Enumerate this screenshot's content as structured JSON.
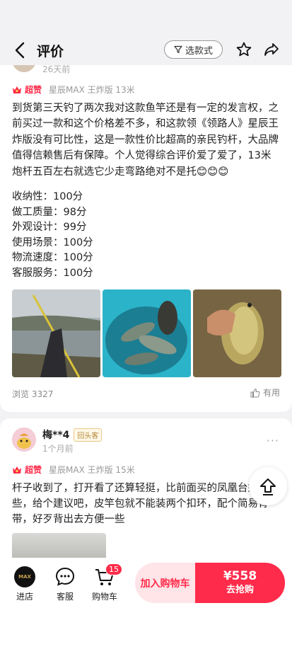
{
  "header": {
    "title": "评价",
    "filter_label": "选款式"
  },
  "review1": {
    "time": "26天前",
    "badge": "超赞",
    "spec": "星辰MAX 王炸版 13米",
    "text": "到货第三天钓了两次我对这款鱼竿还是有一定的发言权，之前买过一款和这个价格差不多，和这款领《领路人》星辰王炸版没有可比性，这是一款性价比超高的亲民钓杆，大品牌值得信赖售后有保障。个人觉得综合评价爱了爱了，13米炮杆五百左右就选它少走弯路绝对不是托😊😊😊",
    "scores": [
      "收纳性：100分",
      "做工质量：98分",
      "外观设计：99分",
      "使用场景：100分",
      "物流速度：100分",
      "客服服务：100分"
    ],
    "views": "浏览 3327",
    "useful_label": "有用"
  },
  "review2": {
    "name": "梅**4",
    "repeat_badge": "回头客",
    "time": "1个月前",
    "more": "···",
    "badge": "超赞",
    "spec": "星辰MAX 王炸版 15米",
    "text": "杆子收到了，打开看了还算轻挺，比前面买的凤凰台好一些，给个建议吧，皮竿包就不能装两个扣环，配个简易背带，好歹背出去方便一些"
  },
  "bottom": {
    "store_label": "进店",
    "store_logo_text": "MAX",
    "service_label": "客服",
    "cart_label": "购物车",
    "cart_count": "15",
    "add_cart_label": "加入购物车",
    "price": "¥558",
    "buy_label": "去抢购"
  },
  "colors": {
    "accent": "#ff2b4a",
    "accent_light": "#ffe4e8",
    "background": "#f2f2f4"
  }
}
